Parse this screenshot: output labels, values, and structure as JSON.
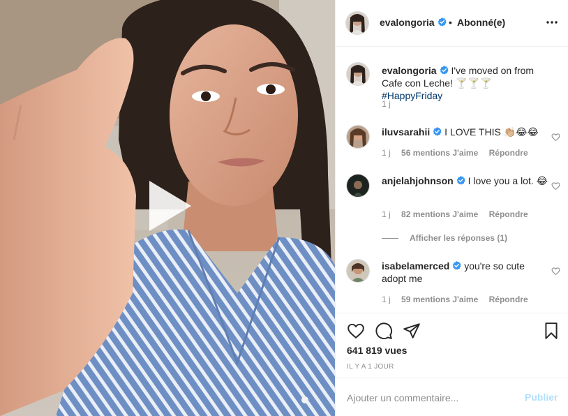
{
  "post": {
    "author": "evalongoria",
    "separator": "•",
    "follow_label": "Abonné(e)",
    "more_icon": "more-options-icon",
    "caption": {
      "text": "I've moved on from Cafe con Leche! 🍸🍸🍸",
      "hashtag": "#HappyFriday",
      "time": "1 j"
    }
  },
  "comments": [
    {
      "user": "iluvsarahii",
      "text": "I LOVE THIS 👏🏼😂😂",
      "time": "1 j",
      "likes": "56 mentions J'aime",
      "reply": "Répondre"
    },
    {
      "user": "anjelahjohnson",
      "text": "I love you a lot. 😂",
      "time": "1 j",
      "likes": "82 mentions J'aime",
      "reply": "Répondre",
      "view_replies": "Afficher les réponses (1)"
    },
    {
      "user": "isabelamerced",
      "text": "you're so cute adopt me",
      "time": "1 j",
      "likes": "59 mentions J'aime",
      "reply": "Répondre"
    }
  ],
  "stats": {
    "views": "641 819 vues",
    "ago": "IL Y A 1 JOUR"
  },
  "composer": {
    "placeholder": "Ajouter un commentaire...",
    "publish": "Publier"
  },
  "colors": {
    "verified": "#3897f0",
    "link": "#00376b",
    "muted": "#8e8e8e",
    "publish_disabled": "#b2dffc"
  }
}
